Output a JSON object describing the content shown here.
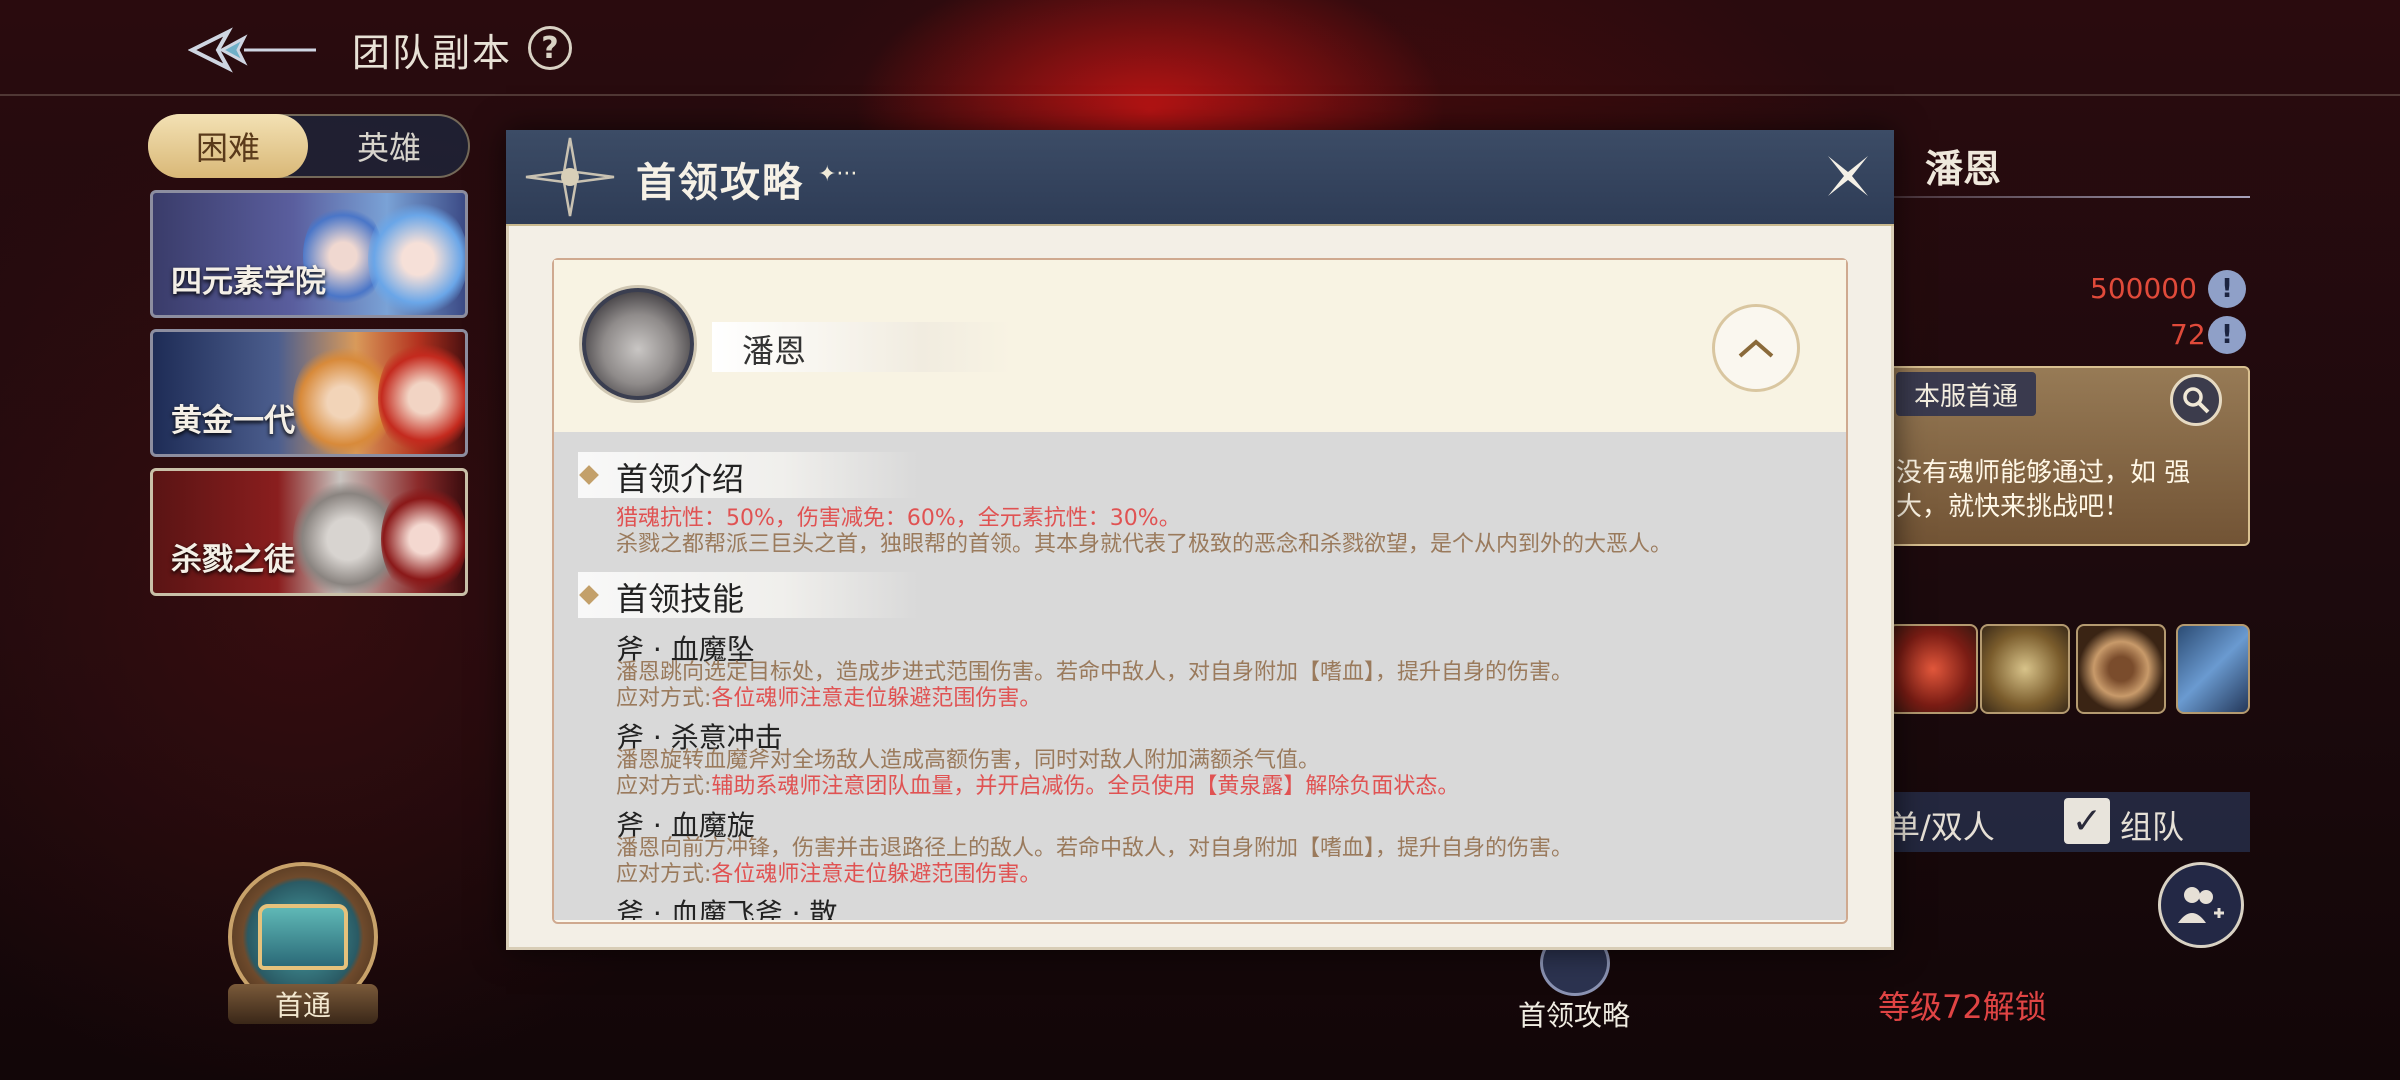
{
  "topbar": {
    "title": "团队副本",
    "help": "?"
  },
  "difficulty": {
    "hard": "困难",
    "hero": "英雄"
  },
  "dungeons": [
    {
      "label": "四元素学院"
    },
    {
      "label": "黄金一代"
    },
    {
      "label": "杀戮之徒"
    }
  ],
  "first_clear": {
    "label": "首通"
  },
  "right_panel": {
    "boss_name": "潘恩",
    "stat1": "500000",
    "stat2": "72",
    "first_pass_tag": "本服首通",
    "first_pass_text": "没有魂师能够通过，如 强大，就快来挑战吧！",
    "mode_single": "单/双人",
    "mode_team": "组队",
    "unlock_text": "等级72解锁",
    "guide_label": "首领攻略"
  },
  "modal": {
    "title": "首领攻略",
    "title_ornament": "✦···",
    "boss_name": "潘恩",
    "intro": {
      "title": "首领介绍",
      "resist": "猎魂抗性：50%，伤害减免：60%，全元素抗性：30%。",
      "desc": "杀戮之都帮派三巨头之首，独眼帮的首领。其本身就代表了极致的恶念和杀戮欲望，是个从内到外的大恶人。"
    },
    "skills": {
      "title": "首领技能",
      "counter_prefix": "应对方式:",
      "items": [
        {
          "name": "斧 · 血魔坠",
          "desc": "潘恩跳向选定目标处，造成步进式范围伤害。若命中敌人，对自身附加【嗜血】，提升自身的伤害。",
          "counter": "各位魂师注意走位躲避范围伤害。"
        },
        {
          "name": "斧 · 杀意冲击",
          "desc": "潘恩旋转血魔斧对全场敌人造成高额伤害，同时对敌人附加满额杀气值。",
          "counter": "辅助系魂师注意团队血量，并开启减伤。全员使用【黄泉露】解除负面状态。"
        },
        {
          "name": "斧 · 血魔旋",
          "desc": "潘恩向前方冲锋，伤害并击退路径上的敌人。若命中敌人，对自身附加【嗜血】，提升自身的伤害。",
          "counter": "各位魂师注意走位躲避范围伤害。"
        },
        {
          "name": "斧 · 血魔飞斧 · 散"
        }
      ]
    }
  },
  "colors": {
    "accent_red": "#e05252",
    "header_blue": "#2e3c56",
    "text_brown": "#9a7a5c"
  }
}
